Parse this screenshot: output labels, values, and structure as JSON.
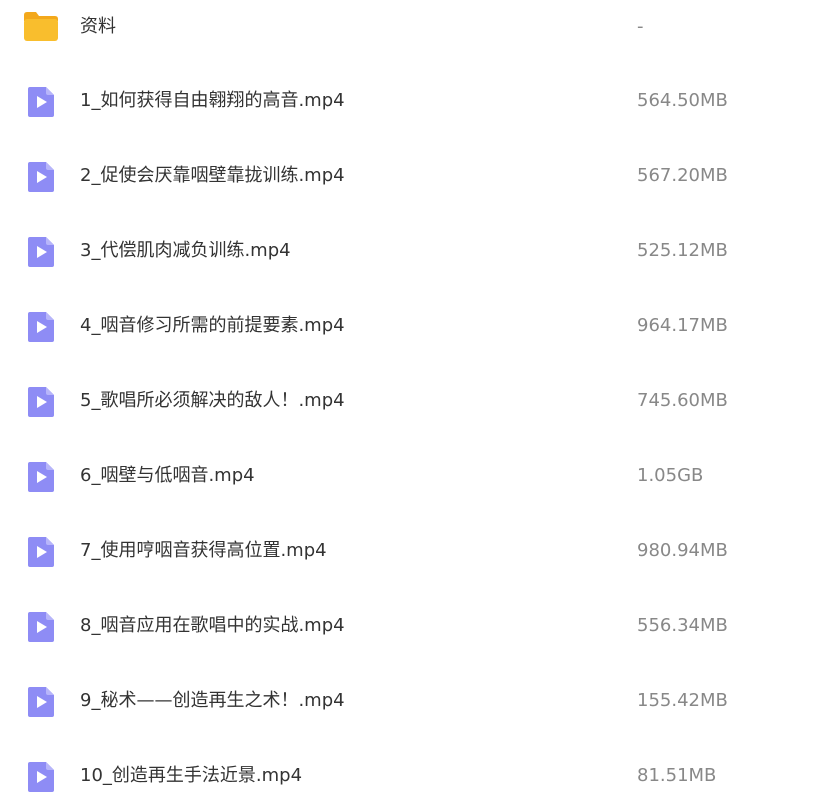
{
  "files": [
    {
      "name": "资料",
      "size": "-",
      "icon": "folder-icon",
      "type": "folder"
    },
    {
      "name": "1_如何获得自由翱翔的高音.mp4",
      "size": "564.50MB",
      "icon": "video-file-icon",
      "type": "video"
    },
    {
      "name": "2_促使会厌靠咽壁靠拢训练.mp4",
      "size": "567.20MB",
      "icon": "video-file-icon",
      "type": "video"
    },
    {
      "name": "3_代偿肌肉减负训练.mp4",
      "size": "525.12MB",
      "icon": "video-file-icon",
      "type": "video"
    },
    {
      "name": "4_咽音修习所需的前提要素.mp4",
      "size": "964.17MB",
      "icon": "video-file-icon",
      "type": "video"
    },
    {
      "name": "5_歌唱所必须解决的敌人！.mp4",
      "size": "745.60MB",
      "icon": "video-file-icon",
      "type": "video"
    },
    {
      "name": "6_咽壁与低咽音.mp4",
      "size": "1.05GB",
      "icon": "video-file-icon",
      "type": "video"
    },
    {
      "name": "7_使用哼咽音获得高位置.mp4",
      "size": "980.94MB",
      "icon": "video-file-icon",
      "type": "video"
    },
    {
      "name": "8_咽音应用在歌唱中的实战.mp4",
      "size": "556.34MB",
      "icon": "video-file-icon",
      "type": "video"
    },
    {
      "name": "9_秘术——创造再生之术！.mp4",
      "size": "155.42MB",
      "icon": "video-file-icon",
      "type": "video"
    },
    {
      "name": "10_创造再生手法近景.mp4",
      "size": "81.51MB",
      "icon": "video-file-icon",
      "type": "video"
    }
  ],
  "colors": {
    "folder": "#F9BE2D",
    "folder_tab": "#F3A81B",
    "video_icon": "#8E8CF5",
    "name_text": "#333333",
    "size_text": "#888888"
  }
}
